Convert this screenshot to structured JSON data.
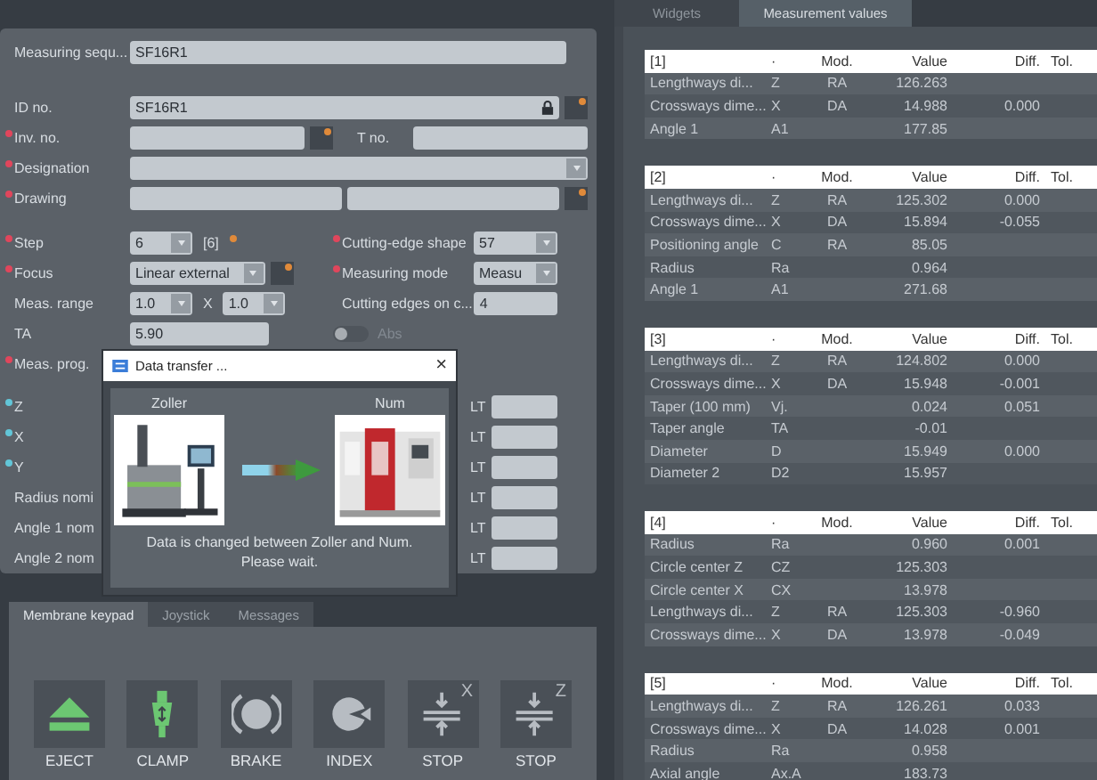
{
  "form": {
    "sequence": {
      "label": "Measuring sequ...",
      "controls": [
        {
          "kind": "text",
          "value": "SF16R1"
        }
      ]
    },
    "header_rows": [
      {
        "label": "ID no.",
        "controls": [
          {
            "kind": "text",
            "value": "SF16R1",
            "locked": true
          },
          {
            "kind": "flag"
          }
        ]
      },
      {
        "label": "Inv. no.",
        "color": "#e0465c",
        "controls": [
          {
            "kind": "text"
          },
          {
            "kind": "flag"
          },
          {
            "kind": "tag",
            "value": "T no."
          },
          {
            "kind": "text"
          }
        ]
      },
      {
        "label": "Designation",
        "color": "#e0465c",
        "controls": [
          {
            "kind": "select"
          }
        ]
      },
      {
        "label": "Drawing",
        "color": "#e0465c",
        "controls": [
          {
            "kind": "text"
          },
          {
            "kind": "text"
          },
          {
            "kind": "flag"
          }
        ]
      }
    ],
    "settings_rows": [
      {
        "left": {
          "label": "Step",
          "color": "#e0465c",
          "controls": [
            {
              "kind": "select",
              "value": "6"
            },
            {
              "kind": "note",
              "value": "[6]"
            },
            {
              "kind": "dot"
            }
          ]
        },
        "right": {
          "label": "Cutting-edge shape",
          "color": "#e0465c",
          "controls": [
            {
              "kind": "select",
              "value": "57"
            }
          ]
        }
      },
      {
        "left": {
          "label": "Focus",
          "color": "#e0465c",
          "controls": [
            {
              "kind": "select",
              "value": "Linear external"
            },
            {
              "kind": "flag"
            }
          ]
        },
        "right": {
          "label": "Measuring mode",
          "color": "#e0465c",
          "controls": [
            {
              "kind": "select",
              "value": "Measu"
            }
          ]
        }
      },
      {
        "left": {
          "label": "Meas. range",
          "controls": [
            {
              "kind": "select",
              "value": "1.0"
            },
            {
              "kind": "note",
              "value": "X"
            },
            {
              "kind": "select",
              "value": "1.0"
            }
          ]
        },
        "right": {
          "label": "Cutting edges on c...",
          "controls": [
            {
              "kind": "text",
              "value": "4"
            }
          ]
        }
      },
      {
        "left": {
          "label": "TA",
          "controls": [
            {
              "kind": "text",
              "value": "5.90"
            }
          ]
        },
        "right": {
          "controls": [
            {
              "kind": "toggle",
              "label": "Abs",
              "on": false,
              "disabled": true
            }
          ]
        }
      },
      {
        "left": {
          "label": "Meas. prog.",
          "color": "#e0465c"
        }
      }
    ],
    "axis_rows": [
      {
        "left": {
          "label": "Z",
          "color": "#62c6d8"
        },
        "right": {
          "controls": [
            {
              "kind": "tag",
              "value": "LT"
            },
            {
              "kind": "text"
            }
          ]
        }
      },
      {
        "left": {
          "label": "X",
          "color": "#62c6d8"
        },
        "right": {
          "controls": [
            {
              "kind": "tag",
              "value": "LT"
            },
            {
              "kind": "text"
            }
          ]
        }
      },
      {
        "left": {
          "label": "Y",
          "color": "#62c6d8"
        },
        "right": {
          "controls": [
            {
              "kind": "tag",
              "value": "LT"
            },
            {
              "kind": "text"
            }
          ]
        }
      },
      {
        "left": {
          "label": "Radius nomi"
        },
        "right": {
          "controls": [
            {
              "kind": "tag",
              "value": "LT"
            },
            {
              "kind": "text"
            }
          ]
        }
      },
      {
        "left": {
          "label": "Angle 1 nom"
        },
        "right": {
          "controls": [
            {
              "kind": "tag",
              "value": "LT"
            },
            {
              "kind": "text"
            }
          ]
        }
      },
      {
        "left": {
          "label": "Angle 2 nom"
        },
        "right": {
          "controls": [
            {
              "kind": "tag",
              "value": "LT"
            },
            {
              "kind": "text"
            }
          ]
        }
      }
    ]
  },
  "dialog": {
    "title": "Data transfer ...",
    "close": "×",
    "source": "Zoller",
    "target": "Num",
    "message": "Data is changed between Zoller and Num. Please wait."
  },
  "keypad": {
    "tabs": [
      {
        "label": "Membrane keypad",
        "selected": true
      },
      {
        "label": "Joystick",
        "selected": false
      },
      {
        "label": "Messages",
        "selected": false
      }
    ],
    "keys": [
      {
        "kind": "eject",
        "label": "EJECT",
        "active": true
      },
      {
        "kind": "clamp",
        "label": "CLAMP",
        "active": true
      },
      {
        "kind": "brake",
        "label": "BRAKE",
        "active": false
      },
      {
        "kind": "index",
        "label": "INDEX",
        "active": false
      },
      {
        "kind": "stop",
        "label": "STOP",
        "axis": "X",
        "active": false
      },
      {
        "kind": "stop",
        "label": "STOP",
        "axis": "Z",
        "active": false
      }
    ]
  },
  "results": {
    "tabs": [
      {
        "label": "Widgets",
        "selected": false
      },
      {
        "label": "Measurement values",
        "selected": true
      }
    ],
    "tables": [
      {
        "columns": [
          "[1]",
          "·",
          "Mod.",
          "Value",
          "Diff.",
          "Tol."
        ],
        "rows": [
          {
            "name": "Lengthways di...",
            "symbol": "Z",
            "mod": "RA",
            "value": "126.263"
          },
          {
            "name": "Crossways dime...",
            "symbol": "X",
            "mod": "DA",
            "value": "14.988",
            "diff": "0.000"
          },
          {
            "name": "Angle 1",
            "symbol": "A1",
            "value": "177.85"
          }
        ]
      },
      {
        "columns": [
          "[2]",
          "·",
          "Mod.",
          "Value",
          "Diff.",
          "Tol."
        ],
        "rows": [
          {
            "name": "Lengthways di...",
            "symbol": "Z",
            "mod": "RA",
            "value": "125.302",
            "diff": "0.000"
          },
          {
            "name": "Crossways dime...",
            "symbol": "X",
            "mod": "DA",
            "value": "15.894",
            "diff": "-0.055"
          },
          {
            "name": "Positioning angle",
            "symbol": "C",
            "mod": "RA",
            "value": "85.05"
          },
          {
            "name": "Radius",
            "symbol": "Ra",
            "value": "0.964"
          },
          {
            "name": "Angle 1",
            "symbol": "A1",
            "value": "271.68"
          }
        ]
      },
      {
        "columns": [
          "[3]",
          "·",
          "Mod.",
          "Value",
          "Diff.",
          "Tol."
        ],
        "rows": [
          {
            "name": "Lengthways di...",
            "symbol": "Z",
            "mod": "RA",
            "value": "124.802",
            "diff": "0.000"
          },
          {
            "name": "Crossways dime...",
            "symbol": "X",
            "mod": "DA",
            "value": "15.948",
            "diff": "-0.001"
          },
          {
            "name": "Taper (100 mm)",
            "symbol": "Vj.",
            "value": "0.024",
            "diff": "0.051"
          },
          {
            "name": "Taper angle",
            "symbol": "TA",
            "value": "-0.01"
          },
          {
            "name": "Diameter",
            "symbol": "D",
            "value": "15.949",
            "diff": "0.000"
          },
          {
            "name": "Diameter 2",
            "symbol": "D2",
            "value": "15.957"
          }
        ]
      },
      {
        "columns": [
          "[4]",
          "·",
          "Mod.",
          "Value",
          "Diff.",
          "Tol."
        ],
        "rows": [
          {
            "name": "Radius",
            "symbol": "Ra",
            "value": "0.960",
            "diff": "0.001"
          },
          {
            "name": "Circle center Z",
            "symbol": "CZ",
            "value": "125.303"
          },
          {
            "name": "Circle center X",
            "symbol": "CX",
            "value": "13.978"
          },
          {
            "name": "Lengthways di...",
            "symbol": "Z",
            "mod": "RA",
            "value": "125.303",
            "diff": "-0.960"
          },
          {
            "name": "Crossways dime...",
            "symbol": "X",
            "mod": "DA",
            "value": "13.978",
            "diff": "-0.049"
          }
        ]
      },
      {
        "columns": [
          "[5]",
          "·",
          "Mod.",
          "Value",
          "Diff.",
          "Tol."
        ],
        "rows": [
          {
            "name": "Lengthways di...",
            "symbol": "Z",
            "mod": "RA",
            "value": "126.261",
            "diff": "0.033"
          },
          {
            "name": "Crossways dime...",
            "symbol": "X",
            "mod": "DA",
            "value": "14.028",
            "diff": "0.001"
          },
          {
            "name": "Radius",
            "symbol": "Ra",
            "value": "0.958"
          },
          {
            "name": "Axial angle",
            "symbol": "Ax.A",
            "value": "183.73"
          }
        ]
      }
    ]
  }
}
